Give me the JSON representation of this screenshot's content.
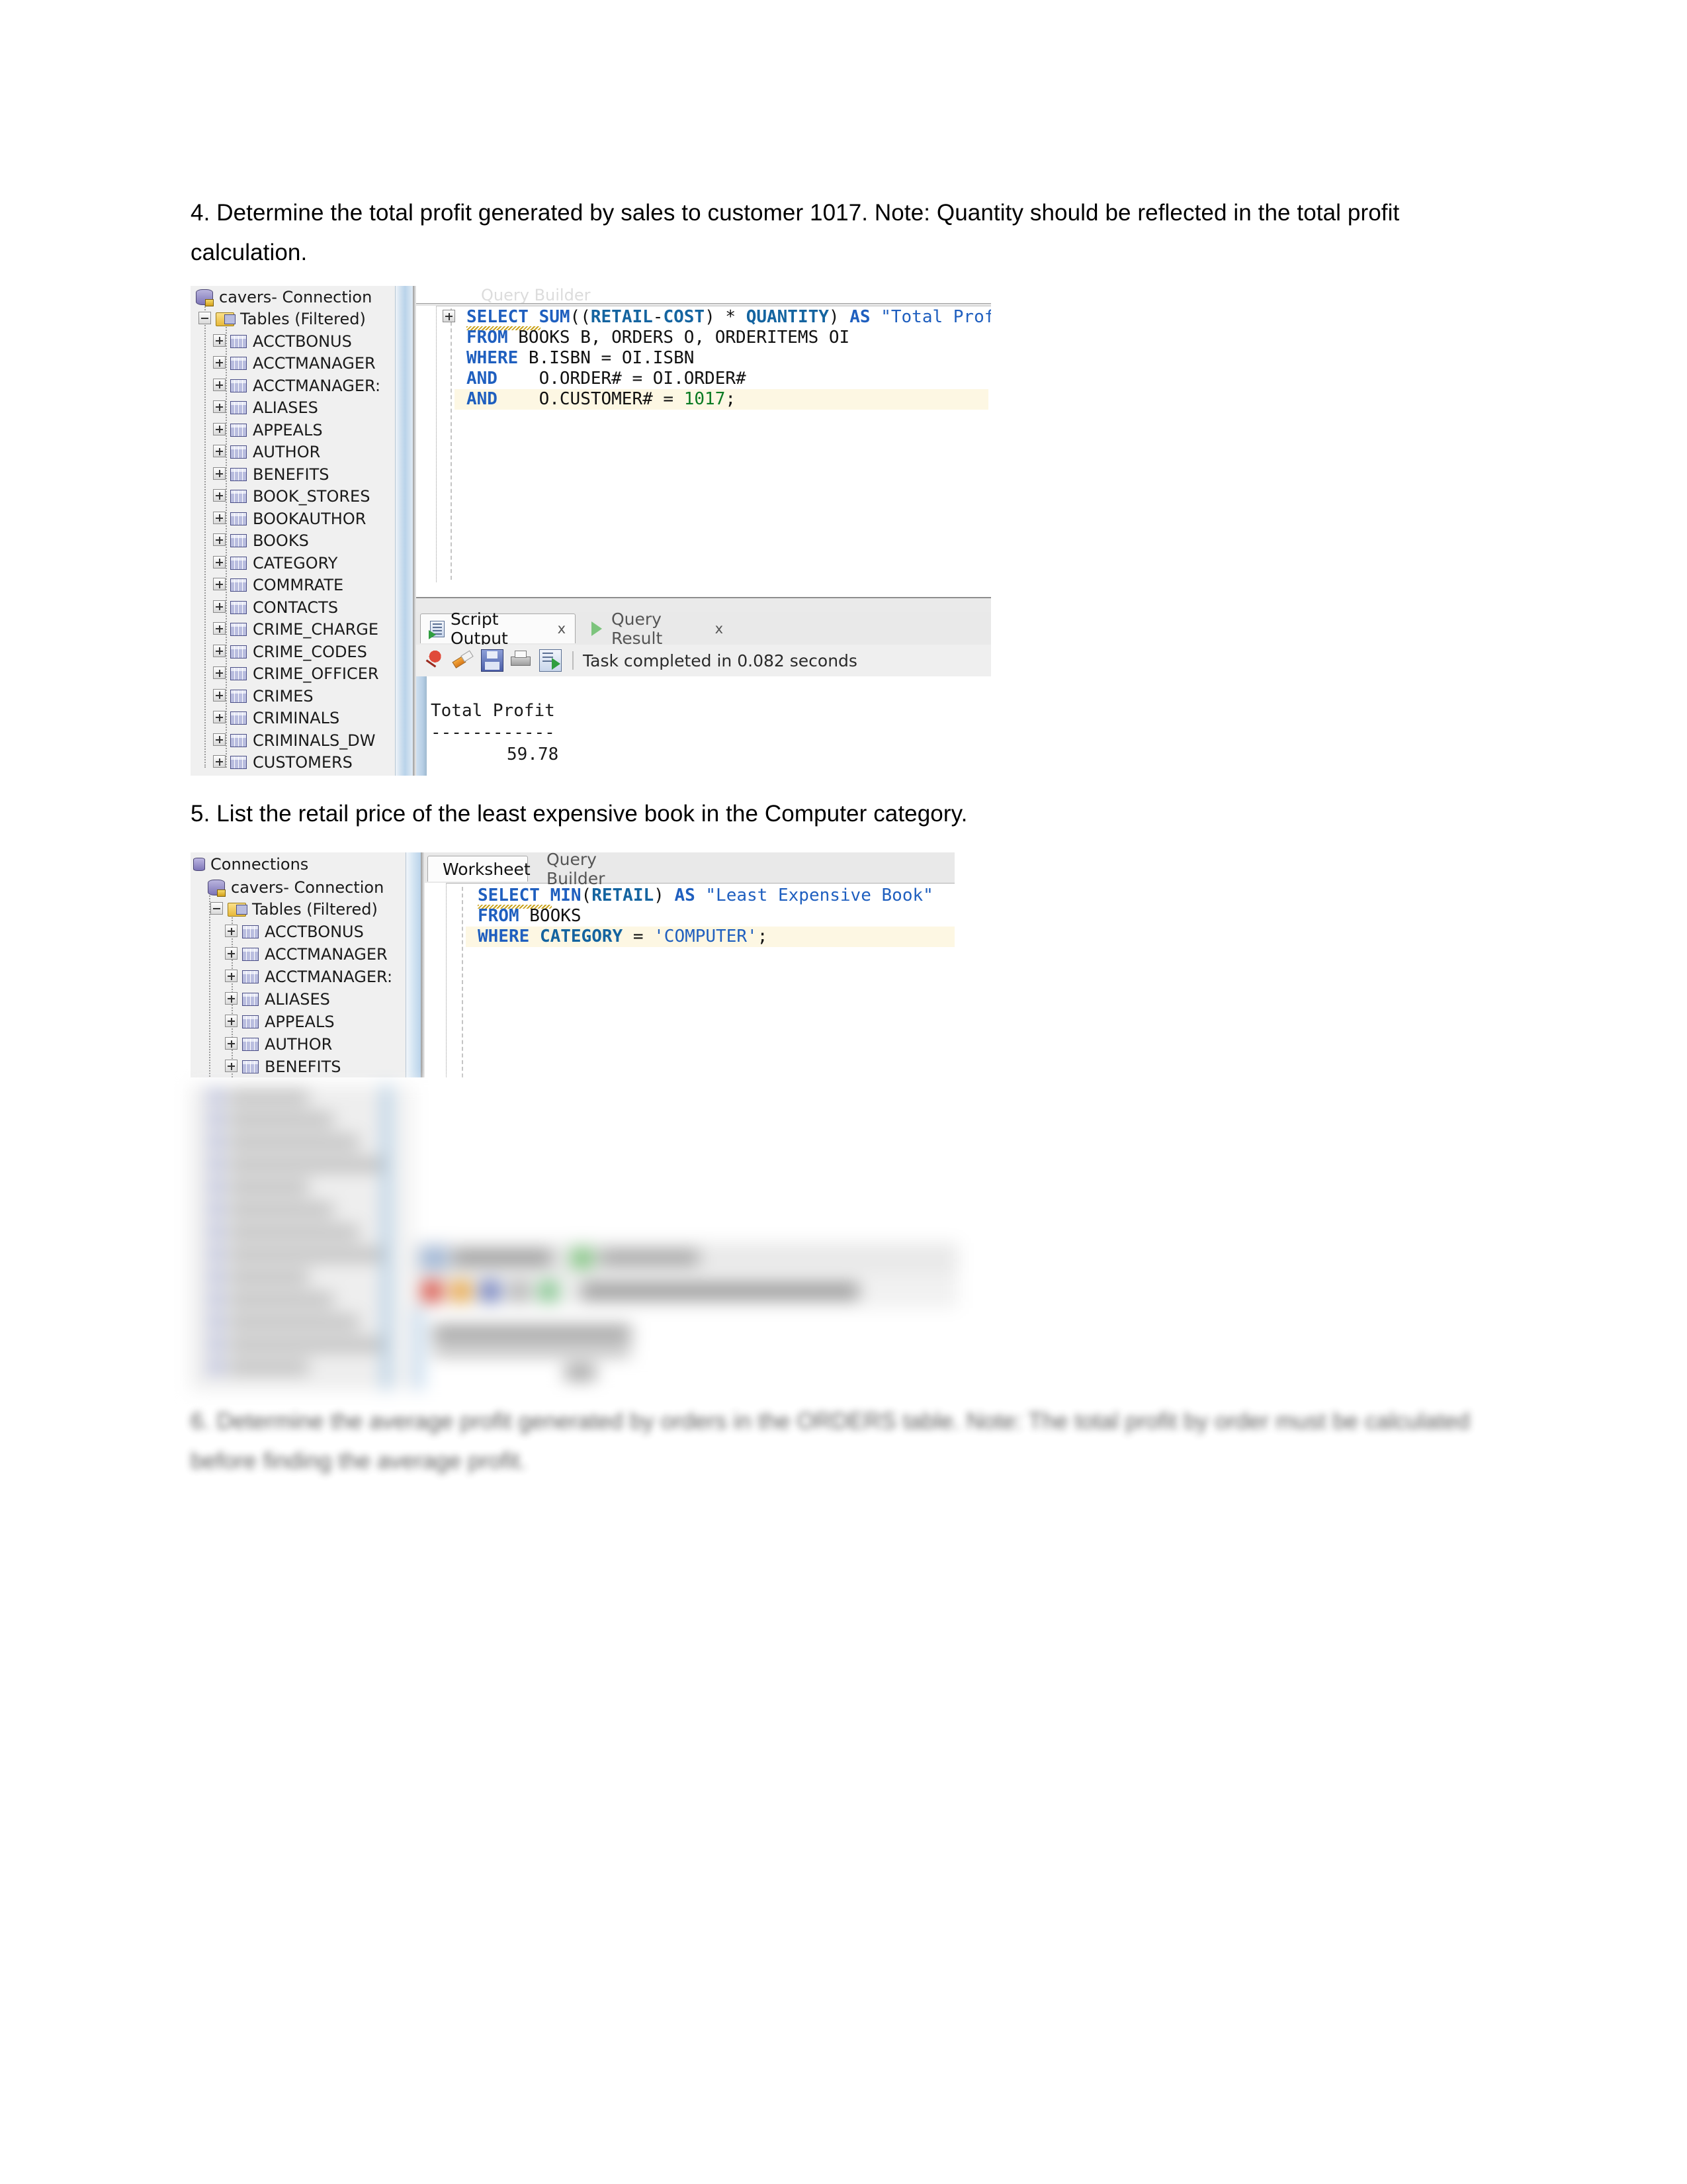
{
  "document": {
    "q4": "4. Determine the total profit generated by sales to customer 1017. Note: Quantity should be reflected in the total profit calculation.",
    "q5": "5. List the retail price of the least expensive book in the Computer category.",
    "q6": "6. Determine the average profit generated by orders in the ORDERS table. Note: The total profit by order must be calculated before finding the average profit."
  },
  "shot1": {
    "tree": {
      "connection_label": "cavers- Connection",
      "tables_node": "Tables (Filtered)",
      "tables": [
        "ACCTBONUS",
        "ACCTMANAGER",
        "ACCTMANAGER:",
        "ALIASES",
        "APPEALS",
        "AUTHOR",
        "BENEFITS",
        "BOOK_STORES",
        "BOOKAUTHOR",
        "BOOKS",
        "CATEGORY",
        "COMMRATE",
        "CONTACTS",
        "CRIME_CHARGE",
        "CRIME_CODES",
        "CRIME_OFFICER",
        "CRIMES",
        "CRIMINALS",
        "CRIMINALS_DW",
        "CUSTOMERS"
      ]
    },
    "editor": {
      "tab_query_builder": "Query Builder",
      "sql_lines": [
        "SELECT SUM((RETAIL-COST) * QUANTITY) AS \"Total Profit\"",
        "FROM BOOKS B, ORDERS O, ORDERITEMS OI",
        "WHERE B.ISBN = OI.ISBN",
        "AND    O.ORDER# = OI.ORDER#",
        "AND    O.CUSTOMER# = 1017;"
      ]
    },
    "output": {
      "tab_script_output": "Script Output",
      "tab_query_result": "Query Result",
      "close_glyph": "x",
      "status": "Task completed in 0.082 seconds",
      "result_header": "Total Profit",
      "result_divider": "------------",
      "result_value": "59.78",
      "toolbar_icons": [
        "pin-icon",
        "eraser-icon",
        "save-icon",
        "print-icon",
        "run-script-icon"
      ]
    }
  },
  "shot2": {
    "tree": {
      "panel_title": "Connections",
      "connection_label": "cavers- Connection",
      "tables_node": "Tables (Filtered)",
      "tables": [
        "ACCTBONUS",
        "ACCTMANAGER",
        "ACCTMANAGER:",
        "ALIASES",
        "APPEALS",
        "AUTHOR",
        "BENEFITS"
      ]
    },
    "editor": {
      "tab_worksheet": "Worksheet",
      "tab_query_builder": "Query Builder",
      "sql_lines": [
        "SELECT MIN(RETAIL) AS \"Least Expensive Book\"",
        "FROM BOOKS",
        "WHERE CATEGORY = 'COMPUTER';"
      ]
    },
    "output": {
      "tab_script_output": "Script Output",
      "tab_query_result": "Query Result",
      "status": "Task completed in 0.089 seconds",
      "result_header": "Least Expensive Book",
      "result_divider": "--------------------",
      "result_value": "25"
    }
  },
  "colors": {
    "keyword": "#1f5fbf",
    "column": "#1464a0",
    "number": "#0a7a22",
    "string": "#1f5fbf",
    "highlight_row": "#fdf7e3",
    "tree_bg": "#f0f0f0",
    "chrome_bg": "#e9e9e9"
  }
}
